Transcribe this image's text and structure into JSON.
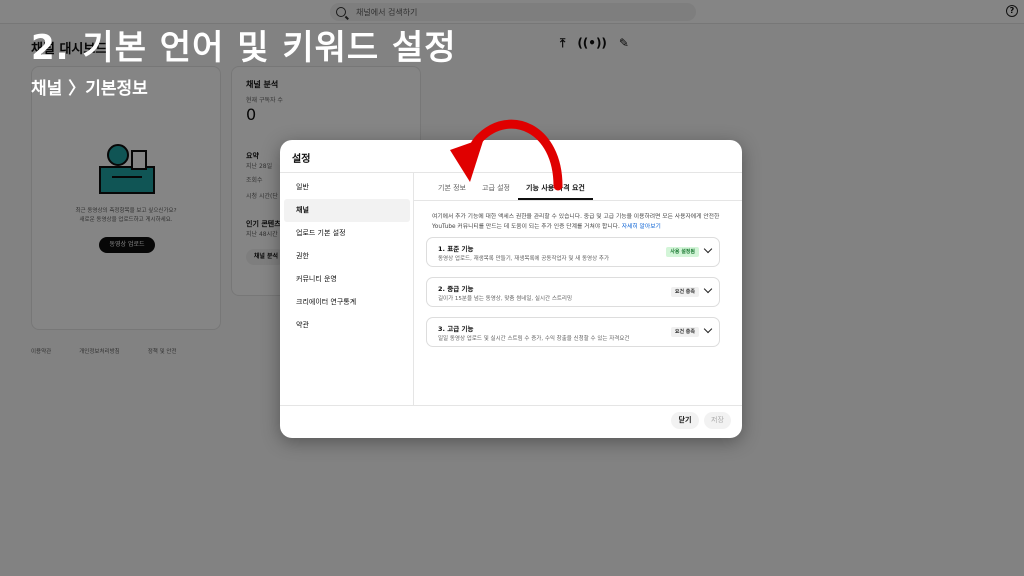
{
  "overlay": {
    "title": "2. 기본 언어 및 키워드 설정",
    "subtitle": "채널 〉기본정보"
  },
  "topbar": {
    "search_placeholder": "채널에서 검색하기"
  },
  "background": {
    "dashboard_title": "채널 대시보드",
    "upload_card": {
      "text_line1": "최근 동영상의 측정항목을 보고 싶으신가요?",
      "text_line2": "새로운 동영상을 업로드하고 게시하세요.",
      "upload_button": "동영상 업로드"
    },
    "analytics_card": {
      "title": "채널 분석",
      "subscribers_label": "현재 구독자 수",
      "subscribers_value": "0",
      "summary_label": "요약",
      "summary_period": "지난 28일",
      "views_label": "조회수",
      "watch_time_label": "시청 시간(단",
      "top_content_label": "인기 콘텐츠",
      "top_content_period": "지난 48시간",
      "analytics_button": "채널 분석"
    },
    "footer_links": [
      "이용약관",
      "개인정보처리방침",
      "정책 및 안전"
    ]
  },
  "dialog": {
    "title": "설정",
    "nav_items": [
      {
        "label": "일반",
        "active": false
      },
      {
        "label": "채널",
        "active": true
      },
      {
        "label": "업로드 기본 설정",
        "active": false
      },
      {
        "label": "권한",
        "active": false
      },
      {
        "label": "커뮤니티 운영",
        "active": false
      },
      {
        "label": "크리에이터 연구통계",
        "active": false
      },
      {
        "label": "약관",
        "active": false
      }
    ],
    "tabs": [
      {
        "label": "기본 정보",
        "active": false
      },
      {
        "label": "고급 설정",
        "active": false
      },
      {
        "label": "기능 사용 자격 요건",
        "active": true
      }
    ],
    "description": "여기에서 추가 기능에 대한 액세스 권한을 관리할 수 있습니다. 중급 및 고급 기능을 이용하려면 모든 사용자에게 안전한 YouTube 커뮤니티를 만드는 데 도움이 되는 추가 인증 단계를 거쳐야 합니다.",
    "learn_more": "자세히 알아보기",
    "features": [
      {
        "title": "1. 표준 기능",
        "desc": "동영상 업로드, 재생목록 만들기, 재생목록에 공동작업자 및 새 동영상 추가",
        "badge": "사용 설정됨",
        "badge_style": "green"
      },
      {
        "title": "2. 중급 기능",
        "desc": "길이가 15분을 넘는 동영상, 맞춤 썸네일, 실시간 스트리밍",
        "badge": "요건 충족",
        "badge_style": "gray"
      },
      {
        "title": "3. 고급 기능",
        "desc": "일일 동영상 업로드 및 실시간 스트림 수 증가, 수익 창출을 신청할 수 있는 자격요건",
        "badge": "요건 충족",
        "badge_style": "gray"
      }
    ],
    "close_button": "닫기",
    "save_button": "저장"
  },
  "colors": {
    "arrow": "#e00000",
    "badge_green_bg": "#d3f5d8",
    "link": "#065fd4"
  }
}
